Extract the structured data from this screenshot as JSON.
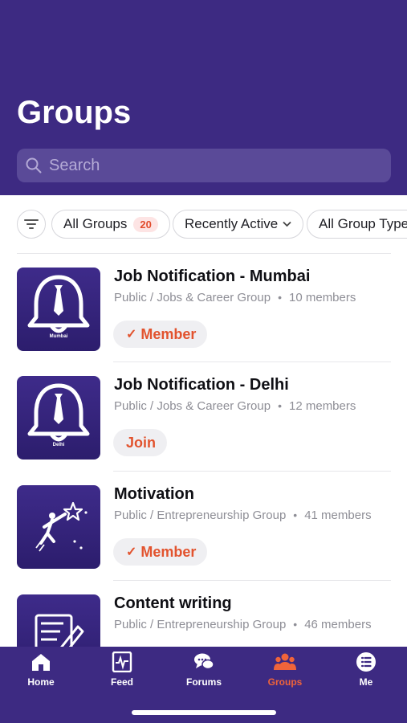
{
  "header": {
    "title": "Groups"
  },
  "search": {
    "placeholder": "Search"
  },
  "filters": {
    "all_groups_label": "All Groups",
    "all_groups_count": "20",
    "sort_label": "Recently Active",
    "type_label": "All Group Types"
  },
  "groups": [
    {
      "name": "Job Notification - Mumbai",
      "type": "Public / Jobs & Career Group",
      "members": "10 members",
      "action": "Member",
      "thumb_icon": "bell-tie-icon",
      "thumb_label": "Mumbai"
    },
    {
      "name": "Job Notification - Delhi",
      "type": "Public / Jobs & Career Group",
      "members": "12 members",
      "action": "Join",
      "thumb_icon": "bell-tie-icon",
      "thumb_label": "Delhi"
    },
    {
      "name": "Motivation",
      "type": "Public / Entrepreneurship Group",
      "members": "41 members",
      "action": "Member",
      "thumb_icon": "reach-star-icon"
    },
    {
      "name": "Content writing",
      "type": "Public / Entrepreneurship Group",
      "members": "46 members",
      "thumb_icon": "writing-icon"
    }
  ],
  "tabs": [
    {
      "label": "Home",
      "icon": "home-icon"
    },
    {
      "label": "Feed",
      "icon": "activity-icon"
    },
    {
      "label": "Forums",
      "icon": "chat-icon"
    },
    {
      "label": "Groups",
      "icon": "people-icon",
      "active": true
    },
    {
      "label": "Me",
      "icon": "menu-icon"
    }
  ],
  "colors": {
    "header": "#3d2a82",
    "accent": "#e2532e",
    "active_tab": "#f0643a"
  }
}
